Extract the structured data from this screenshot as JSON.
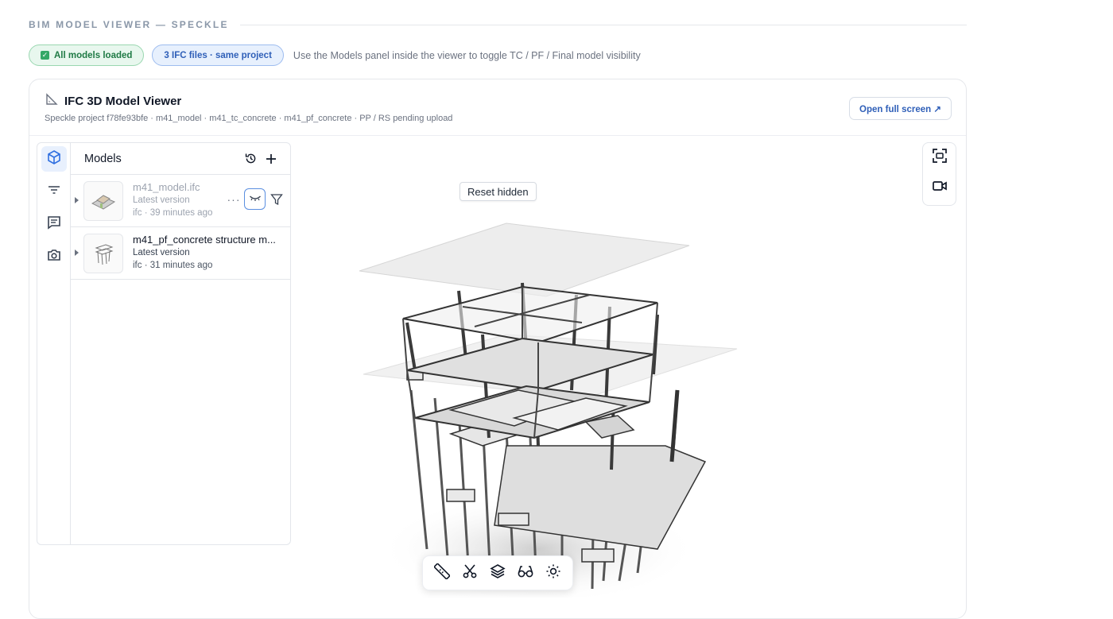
{
  "section": {
    "title": "BIM MODEL VIEWER — SPECKLE"
  },
  "status": {
    "loaded_label": "All models loaded",
    "files_label": "3 IFC files · same project",
    "hint": "Use the Models panel inside the viewer to toggle TC / PF / Final model visibility",
    "loaded_color": "#34a866",
    "files_color": "#2f5fb8"
  },
  "card": {
    "title": "IFC 3D Model Viewer",
    "title_icon": "ruler-triangle-icon",
    "subtitle": "Speckle project f78fe93bfe  ·  m41_model · m41_tc_concrete · m41_pf_concrete  ·  PP / RS pending upload",
    "fullscreen_label": "Open full screen ↗"
  },
  "viewer": {
    "reset_label": "Reset hidden",
    "rail_icons": [
      "cube-icon",
      "filter-lines-icon",
      "comment-icon",
      "camera-icon"
    ],
    "right_tools": [
      "frame-icon",
      "video-camera-icon"
    ],
    "bottom_tools": [
      "ruler-icon",
      "scissors-icon",
      "layers-icon",
      "glasses-icon",
      "sun-icon"
    ],
    "accent": "#2f6fe0"
  },
  "models_panel": {
    "title": "Models",
    "header_icons": [
      "history-icon",
      "plus-icon"
    ],
    "items": [
      {
        "name": "m41_model.ifc",
        "version": "Latest version",
        "meta": "ifc · 39 minutes ago",
        "hidden": true
      },
      {
        "name": "m41_pf_concrete structure m...",
        "version": "Latest version",
        "meta": "ifc · 31 minutes ago",
        "hidden": false
      }
    ]
  }
}
